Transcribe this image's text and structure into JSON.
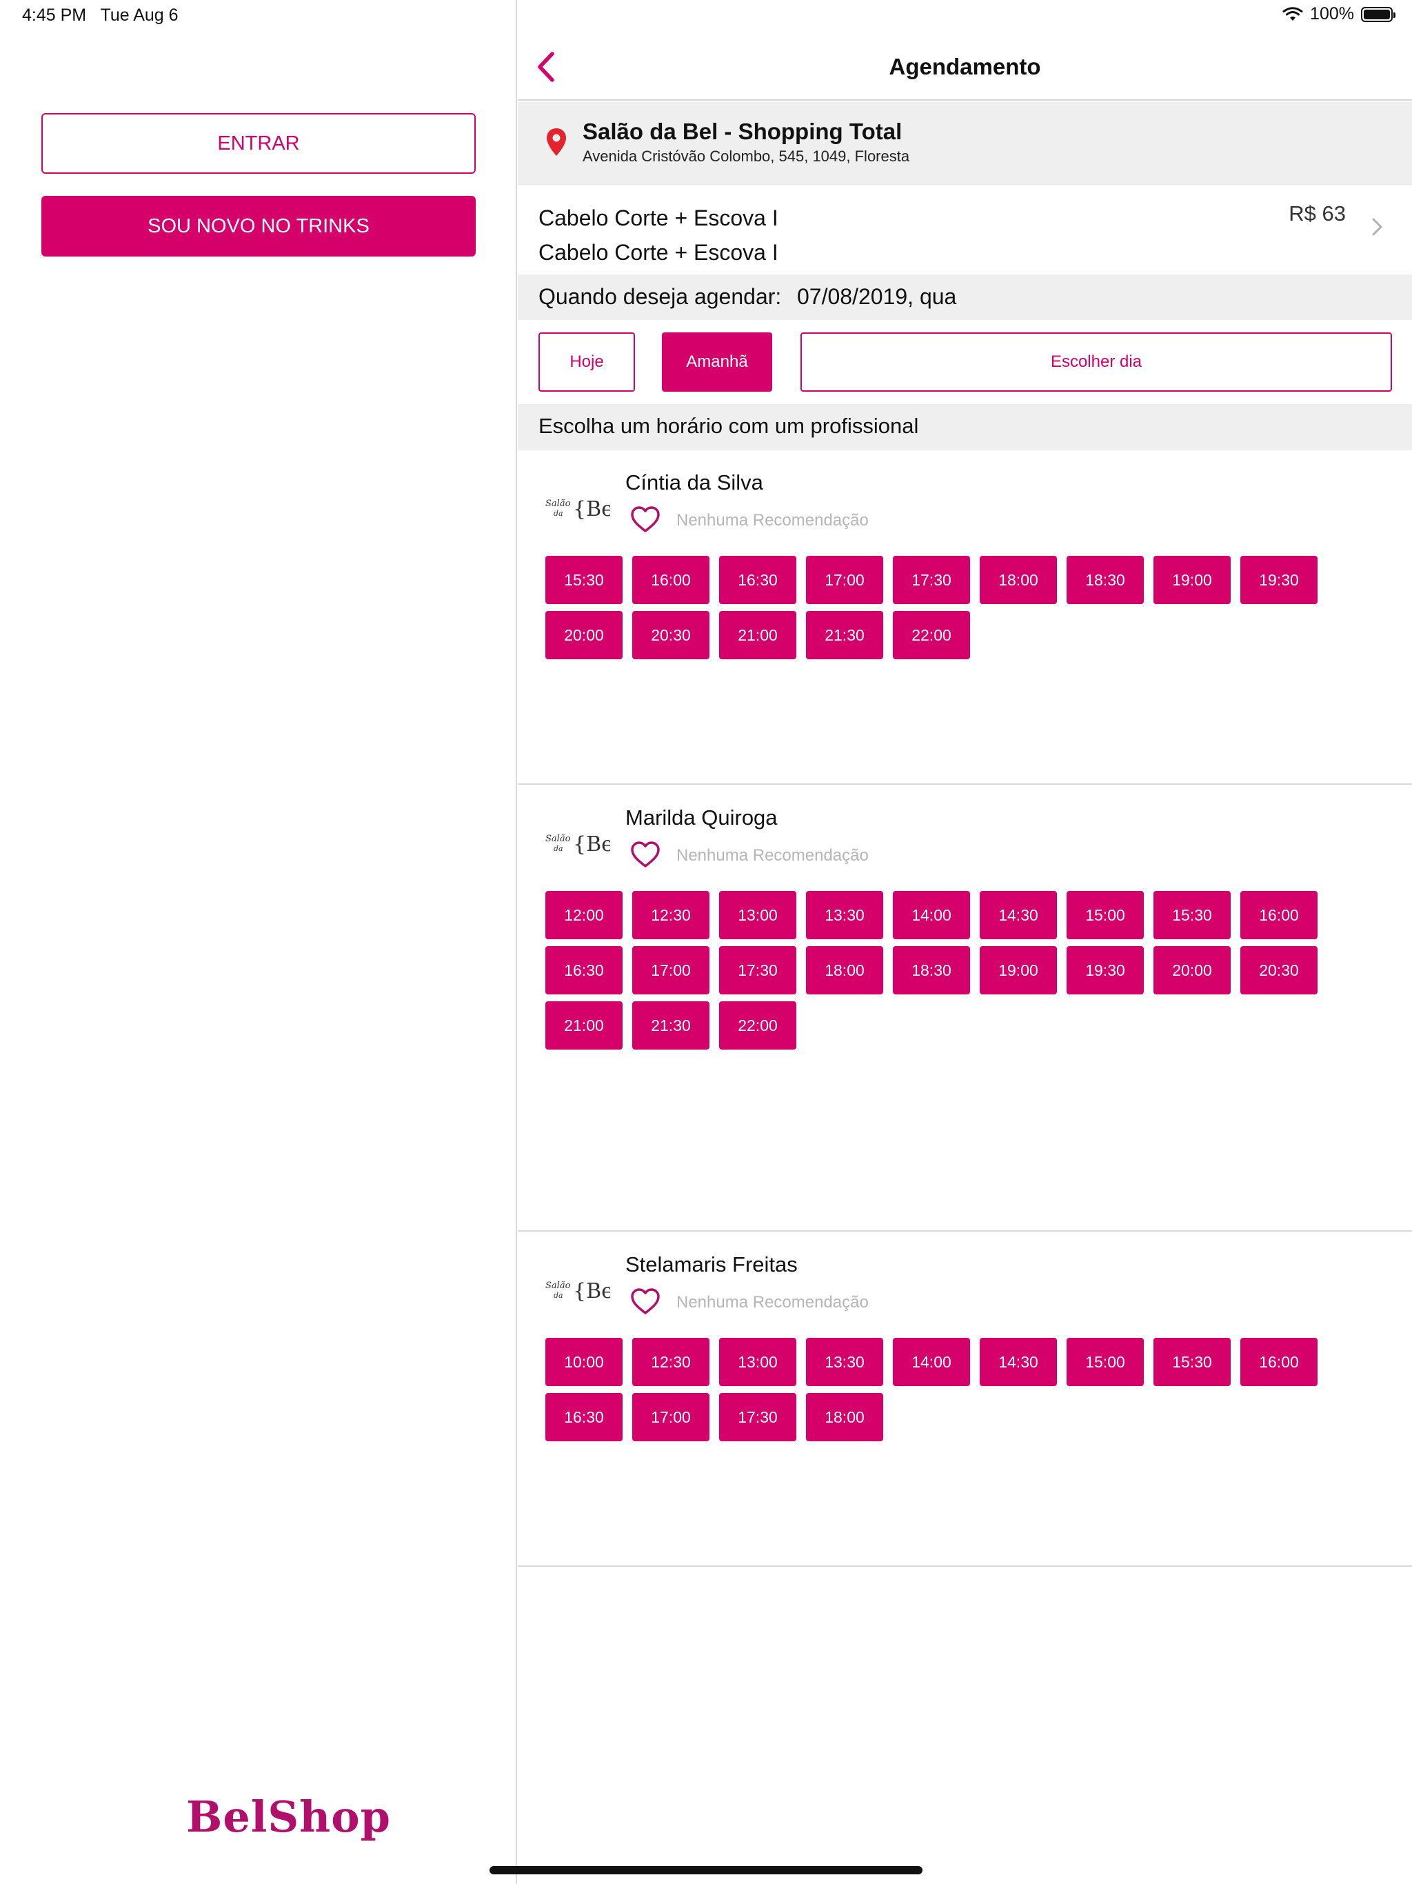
{
  "status_bar": {
    "time": "4:45 PM",
    "date": "Tue Aug 6",
    "battery": "100%",
    "battery_level": 1.0
  },
  "left": {
    "login_label": "ENTRAR",
    "signup_label": "SOU NOVO NO TRINKS",
    "brand": "BelShop"
  },
  "nav": {
    "title": "Agendamento",
    "back_icon": "chevron-left-icon"
  },
  "salon": {
    "name": "Salão da Bel - Shopping Total",
    "address": "Avenida Cristóvão Colombo, 545, 1049, Floresta"
  },
  "service": {
    "line1": "Cabelo Corte + Escova I",
    "line2": "Cabelo Corte + Escova I",
    "price": "R$ 63"
  },
  "date": {
    "label": "Quando deseja agendar:",
    "value": "07/08/2019, qua"
  },
  "day_buttons": {
    "today": "Hoje",
    "tomorrow": "Amanhã",
    "choose": "Escolher dia"
  },
  "professionals_header": "Escolha um horário com um profissional",
  "professionals": [
    {
      "name": "Cíntia da Silva",
      "recommendation": "Nenhuma Recomendação",
      "logo_text": "Salão da Bel",
      "slots": [
        "15:30",
        "16:00",
        "16:30",
        "17:00",
        "17:30",
        "18:00",
        "18:30",
        "19:00",
        "19:30",
        "20:00",
        "20:30",
        "21:00",
        "21:30",
        "22:00"
      ]
    },
    {
      "name": "Marilda Quiroga",
      "recommendation": "Nenhuma Recomendação",
      "logo_text": "Salão da Bel",
      "slots": [
        "12:00",
        "12:30",
        "13:00",
        "13:30",
        "14:00",
        "14:30",
        "15:00",
        "15:30",
        "16:00",
        "16:30",
        "17:00",
        "17:30",
        "18:00",
        "18:30",
        "19:00",
        "19:30",
        "20:00",
        "20:30",
        "21:00",
        "21:30",
        "22:00"
      ]
    },
    {
      "name": "Stelamaris Freitas",
      "recommendation": "Nenhuma Recomendação",
      "logo_text": "Salão da Bel",
      "slots": [
        "10:00",
        "12:30",
        "13:00",
        "13:30",
        "14:00",
        "14:30",
        "15:00",
        "15:30",
        "16:00",
        "16:30",
        "17:00",
        "17:30",
        "18:00"
      ]
    }
  ],
  "colors": {
    "accent": "#d6006b",
    "panel_gray": "#efefef",
    "brand": "#b0106b"
  }
}
